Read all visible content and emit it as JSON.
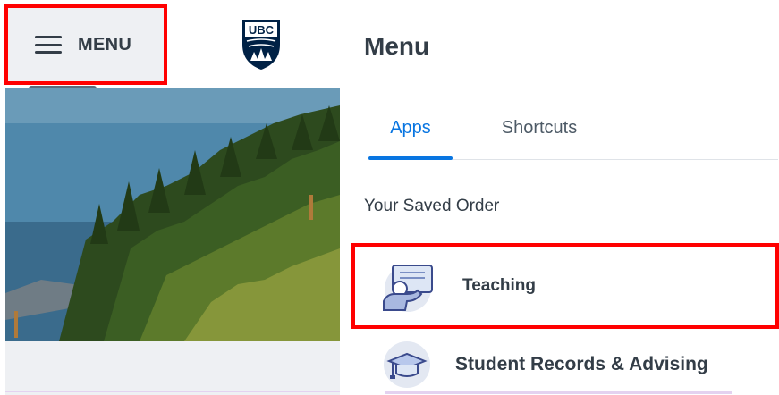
{
  "header": {
    "menu_label": "MENU",
    "logo_text": "UBC"
  },
  "menu_panel": {
    "title": "Menu",
    "tabs": [
      {
        "label": "Apps",
        "active": true
      },
      {
        "label": "Shortcuts",
        "active": false
      }
    ],
    "section_label": "Your Saved Order",
    "items": [
      {
        "label": "Teaching",
        "icon": "teaching-icon",
        "highlighted": true
      },
      {
        "label": "Student Records & Advising",
        "icon": "graduation-cap-icon",
        "highlighted": false
      }
    ]
  },
  "colors": {
    "accent": "#0875e1",
    "highlight": "#ff0000",
    "text": "#333d47",
    "ubc_navy": "#002145"
  }
}
